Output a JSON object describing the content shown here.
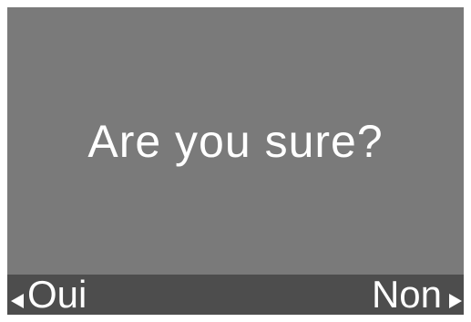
{
  "dialog": {
    "message": "Are you sure?"
  },
  "softkeys": {
    "left_label": "Oui",
    "right_label": "Non",
    "left_icon": "triangle-left-icon",
    "right_icon": "triangle-right-icon"
  },
  "colors": {
    "screen_background": "#7a7a7a",
    "softkey_bar_background": "#4d4d4d",
    "text": "#ffffff"
  }
}
